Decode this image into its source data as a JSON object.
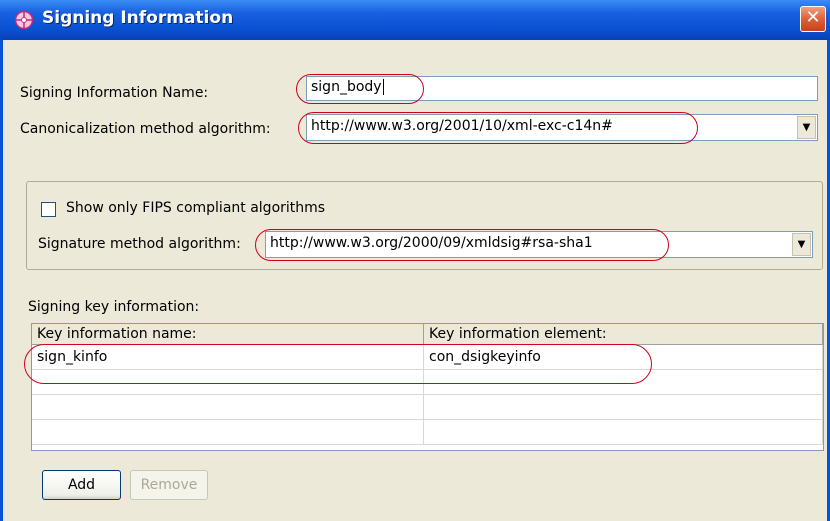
{
  "window": {
    "title": "Signing Information",
    "close_label": "✕"
  },
  "signing_name": {
    "label": "Signing Information Name:",
    "value": "sign_body"
  },
  "canonicalization": {
    "label": "Canonicalization method algorithm:",
    "value": "http://www.w3.org/2001/10/xml-exc-c14n#"
  },
  "fips_checkbox": {
    "label": "Show only FIPS compliant algorithms",
    "checked": false
  },
  "signature": {
    "label": "Signature method algorithm:",
    "value": "http://www.w3.org/2000/09/xmldsig#rsa-sha1"
  },
  "key_section": {
    "label": "Signing key information:"
  },
  "key_table": {
    "headers": [
      "Key information name:",
      "Key information element:"
    ],
    "rows": [
      [
        "sign_kinfo",
        "con_dsigkeyinfo"
      ],
      [
        "",
        ""
      ],
      [
        "",
        ""
      ],
      [
        "",
        ""
      ]
    ]
  },
  "buttons": {
    "add": "Add",
    "remove": "Remove"
  },
  "icons": {
    "title": "crosshair-compass-icon",
    "dropdown": "chevron-down-icon"
  },
  "colors": {
    "titlebar": "#0a52d4",
    "highlight": "#d0001a"
  }
}
